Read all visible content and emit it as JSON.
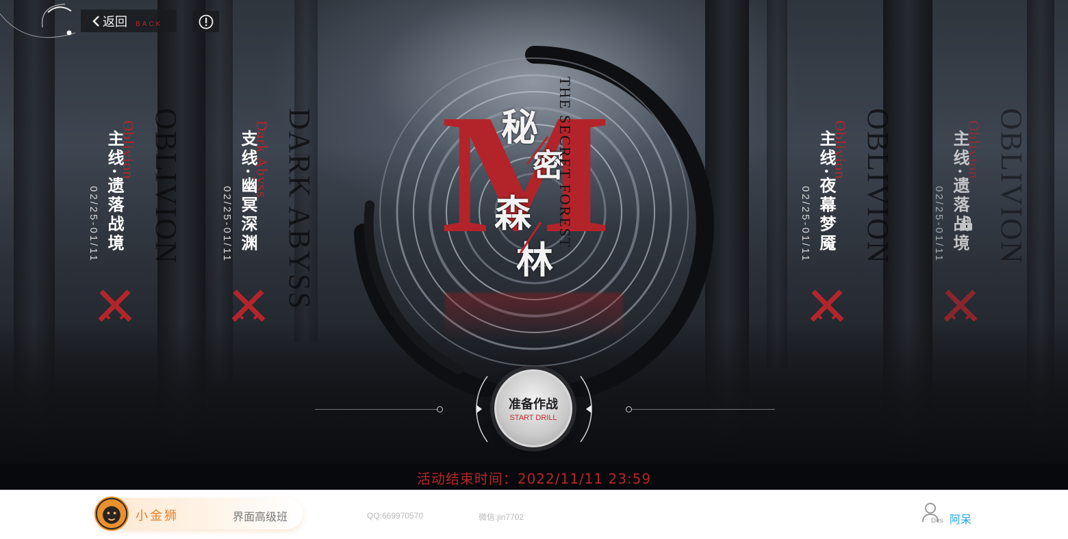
{
  "nav": {
    "back_label": "返回",
    "back_sub": "BACK"
  },
  "chapters": [
    {
      "title": "主线·遗落战境",
      "en": "Oblivion",
      "bg_en": "OBLIVION",
      "date": "02/25-01/11",
      "locked": false
    },
    {
      "title": "支线·幽冥深渊",
      "en": "Dark Abyss",
      "bg_en": "DARK ABYSS",
      "date": "02/25-01/11",
      "locked": false
    },
    {
      "title": "主线·夜幕梦魇",
      "en": "Oblivion",
      "bg_en": "OBLIVION",
      "date": "02/25-01/11",
      "locked": false
    },
    {
      "title": "主线·遗落战境",
      "en": "Oblivion",
      "bg_en": "OBLIVION",
      "date": "02/25-01/11",
      "locked": true
    }
  ],
  "logo": {
    "letter": "M",
    "chars": [
      "秘",
      "密",
      "森",
      "林"
    ],
    "subtitle": "THE SECRET FOREST"
  },
  "start": {
    "label": "准备作战",
    "sub": "START DRILL"
  },
  "event": {
    "end_time": "活动结束时间：2022/11/11 23:59"
  },
  "footer": {
    "brand_name": "小金狮",
    "course": "界面高级班",
    "qq": "QQ:669970570",
    "wechat": "微信:jin7702",
    "user_tag": "Des",
    "user_name": "阿呆"
  },
  "colors": {
    "accent_red": "#b3252b",
    "brand_orange": "#e8802a",
    "link_blue": "#24a6e0"
  }
}
